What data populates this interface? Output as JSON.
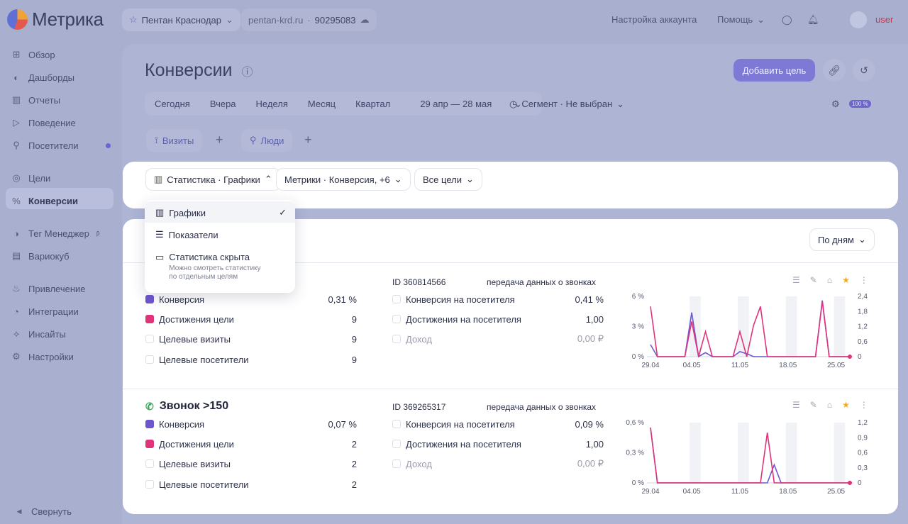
{
  "app": {
    "logo_text": "Метрика"
  },
  "topbar": {
    "counter_name": "Пентан Краснодар",
    "site": "pentan-krd.ru",
    "counter_id": "90295083",
    "account_settings": "Настройка аккаунта",
    "help": "Помощь",
    "user": "user"
  },
  "sidebar": {
    "items": [
      {
        "label": "Обзор",
        "icon": "grid-icon"
      },
      {
        "label": "Дашборды",
        "icon": "dashboard-icon"
      },
      {
        "label": "Отчеты",
        "icon": "reports-icon"
      },
      {
        "label": "Поведение",
        "icon": "play-icon"
      },
      {
        "label": "Посетители",
        "icon": "person-icon"
      },
      {
        "label": "Цели",
        "icon": "target-icon"
      },
      {
        "label": "Конверсии",
        "icon": "percent-icon"
      },
      {
        "label": "Тег Менеджер",
        "icon": "tag-manager-icon"
      },
      {
        "label": "Вариокуб",
        "icon": "variocube-icon"
      },
      {
        "label": "Привлечение",
        "icon": "fire-icon"
      },
      {
        "label": "Интеграции",
        "icon": "integrations-icon"
      },
      {
        "label": "Инсайты",
        "icon": "insights-icon"
      },
      {
        "label": "Настройки",
        "icon": "gear-icon"
      }
    ],
    "beta_mark": "β",
    "collapse": "Свернуть"
  },
  "page": {
    "title": "Конверсии",
    "add_goal": "Добавить цель",
    "periods": [
      "Сегодня",
      "Вчера",
      "Неделя",
      "Месяц",
      "Квартал"
    ],
    "date_range": "29 апр — 28 мая",
    "segment": "Сегмент · Не выбран",
    "sampling": "100 %",
    "chips": {
      "visits": "Визиты",
      "people": "Люди"
    }
  },
  "filters": {
    "view": "Статистика · Графики",
    "metrics": "Метрики · Конверсия, +6",
    "goals": "Все цели",
    "group_by": "По дням"
  },
  "dropdown": {
    "items": [
      {
        "label": "Графики",
        "selected": true
      },
      {
        "label": "Показатели",
        "selected": false
      },
      {
        "label": "Статистика скрыта",
        "note1": "Можно смотреть статистику",
        "note2": "по отдельным целям",
        "selected": false
      }
    ]
  },
  "goals": [
    {
      "name": "",
      "id_label": "ID 360814566",
      "type": "передача данных о звонках",
      "left": [
        {
          "label": "Конверсия",
          "value": "0,31 %"
        },
        {
          "label": "Достижения цели",
          "value": "9"
        },
        {
          "label": "Целевые визиты",
          "value": "9"
        },
        {
          "label": "Целевые посетители",
          "value": "9"
        }
      ],
      "right": [
        {
          "label": "Конверсия на посетителя",
          "value": "0,41 %"
        },
        {
          "label": "Достижения на посетителя",
          "value": "1,00"
        },
        {
          "label": "Доход",
          "value": "0,00 ₽"
        }
      ]
    },
    {
      "name": "Звонок >150",
      "id_label": "ID 369265317",
      "type": "передача данных о звонках",
      "left": [
        {
          "label": "Конверсия",
          "value": "0,07 %"
        },
        {
          "label": "Достижения цели",
          "value": "2"
        },
        {
          "label": "Целевые визиты",
          "value": "2"
        },
        {
          "label": "Целевые посетители",
          "value": "2"
        }
      ],
      "right": [
        {
          "label": "Конверсия на посетителя",
          "value": "0,09 %"
        },
        {
          "label": "Достижения на посетителя",
          "value": "1,00"
        },
        {
          "label": "Доход",
          "value": "0,00 ₽"
        }
      ]
    }
  ],
  "colors": {
    "accent": "#7f79d6",
    "conversion": "#6e56cf",
    "achievements": "#e0337a"
  },
  "chart_data": [
    {
      "type": "line",
      "x_ticks": [
        "29.04",
        "04.05",
        "11.05",
        "18.05",
        "25.05"
      ],
      "y_left_ticks": [
        "6 %",
        "3 %",
        "0 %"
      ],
      "y_right_ticks": [
        "2,4",
        "1,8",
        "1,2",
        "0,6",
        "0"
      ],
      "ylim_left": [
        0,
        6
      ],
      "ylim_right": [
        0,
        2.4
      ],
      "series": [
        {
          "name": "Конверсия",
          "axis": "left",
          "color": "#6e56cf",
          "values": [
            1.2,
            0,
            0,
            0,
            0,
            0,
            4.4,
            0,
            0.4,
            0,
            0,
            0,
            0,
            0.5,
            0.3,
            0,
            0,
            0,
            0,
            0,
            0,
            0,
            0,
            0,
            0,
            5.6,
            0,
            0,
            0,
            0
          ]
        },
        {
          "name": "Достижения цели",
          "axis": "right",
          "color": "#e0337a",
          "values": [
            2,
            0,
            0,
            0,
            0,
            0,
            1.4,
            0,
            1,
            0,
            0,
            0,
            0,
            1,
            0,
            1.25,
            2,
            0,
            0,
            0,
            0,
            0,
            0,
            0,
            0,
            2.2,
            0,
            0,
            0,
            0
          ]
        }
      ]
    },
    {
      "type": "line",
      "x_ticks": [
        "29.04",
        "04.05",
        "11.05",
        "18.05",
        "25.05"
      ],
      "y_left_ticks": [
        "0,6 %",
        "0,3 %",
        "0 %"
      ],
      "y_right_ticks": [
        "1,2",
        "0,9",
        "0,6",
        "0,3",
        "0"
      ],
      "ylim_left": [
        0,
        0.6
      ],
      "ylim_right": [
        0,
        1.2
      ],
      "series": [
        {
          "name": "Конверсия",
          "axis": "left",
          "color": "#6e56cf",
          "values": [
            0.55,
            0,
            0,
            0,
            0,
            0,
            0,
            0,
            0,
            0,
            0,
            0,
            0,
            0,
            0,
            0,
            0,
            0,
            0.18,
            0,
            0,
            0,
            0,
            0,
            0,
            0,
            0,
            0,
            0,
            0
          ]
        },
        {
          "name": "Достижения цели",
          "axis": "right",
          "color": "#e0337a",
          "values": [
            1.1,
            0,
            0,
            0,
            0,
            0,
            0,
            0,
            0,
            0,
            0,
            0,
            0,
            0,
            0,
            0,
            0,
            1,
            0,
            0,
            0,
            0,
            0,
            0,
            0,
            0,
            0,
            0,
            0,
            0
          ]
        }
      ]
    }
  ]
}
